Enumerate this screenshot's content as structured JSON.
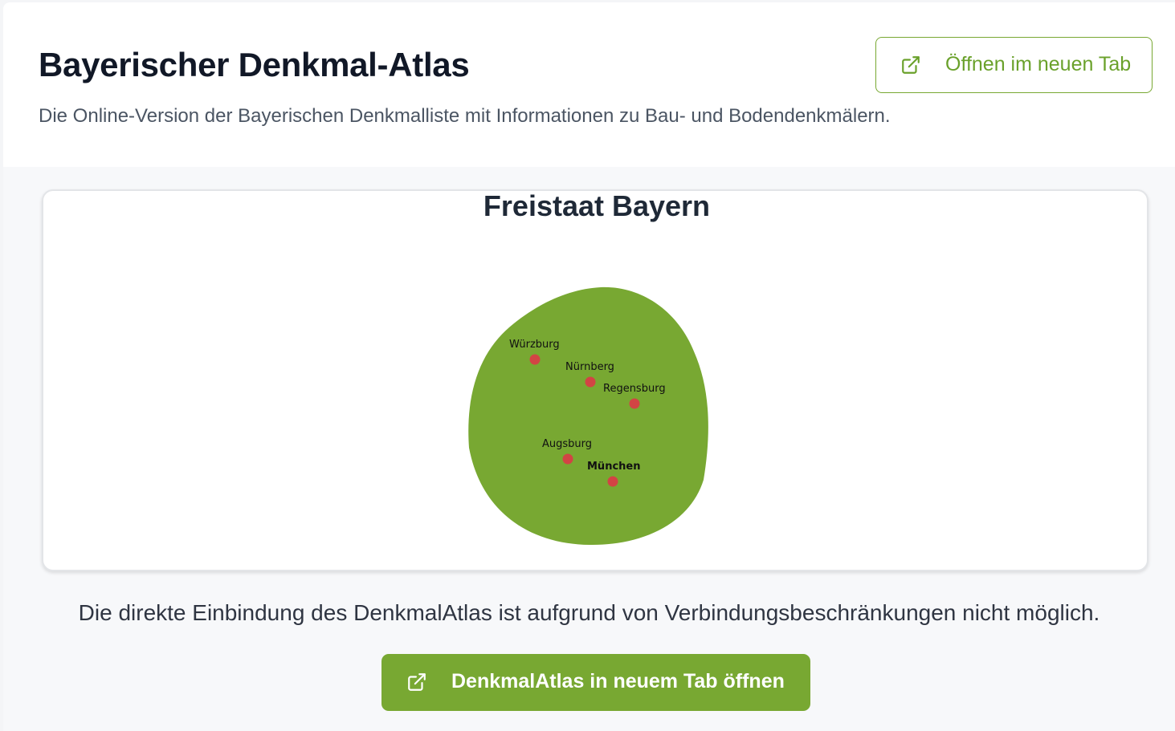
{
  "header": {
    "title": "Bayerischer Denkmal-Atlas",
    "subtitle": "Die Online-Version der Bayerischen Denkmalliste mit Informationen zu Bau- und Bodendenkmälern.",
    "open_tab_button": {
      "label": "Öffnen im neuen Tab",
      "icon": "external-link-icon"
    }
  },
  "map": {
    "title": "Freistaat Bayern",
    "region_color": "#78a832",
    "marker_color": "#d24444",
    "cities": [
      {
        "name": "Würzburg",
        "capital": false
      },
      {
        "name": "Nürnberg",
        "capital": false
      },
      {
        "name": "Regensburg",
        "capital": false
      },
      {
        "name": "Augsburg",
        "capital": false
      },
      {
        "name": "München",
        "capital": true
      }
    ]
  },
  "notice": {
    "text": "Die direkte Einbindung des DenkmalAtlas ist aufgrund von Verbindungsbeschränkungen nicht möglich."
  },
  "primary_button": {
    "label": "DenkmalAtlas in neuem Tab öffnen",
    "icon": "external-link-icon"
  },
  "colors": {
    "accent": "#78a832",
    "title": "#111827",
    "text": "#4b5563"
  }
}
